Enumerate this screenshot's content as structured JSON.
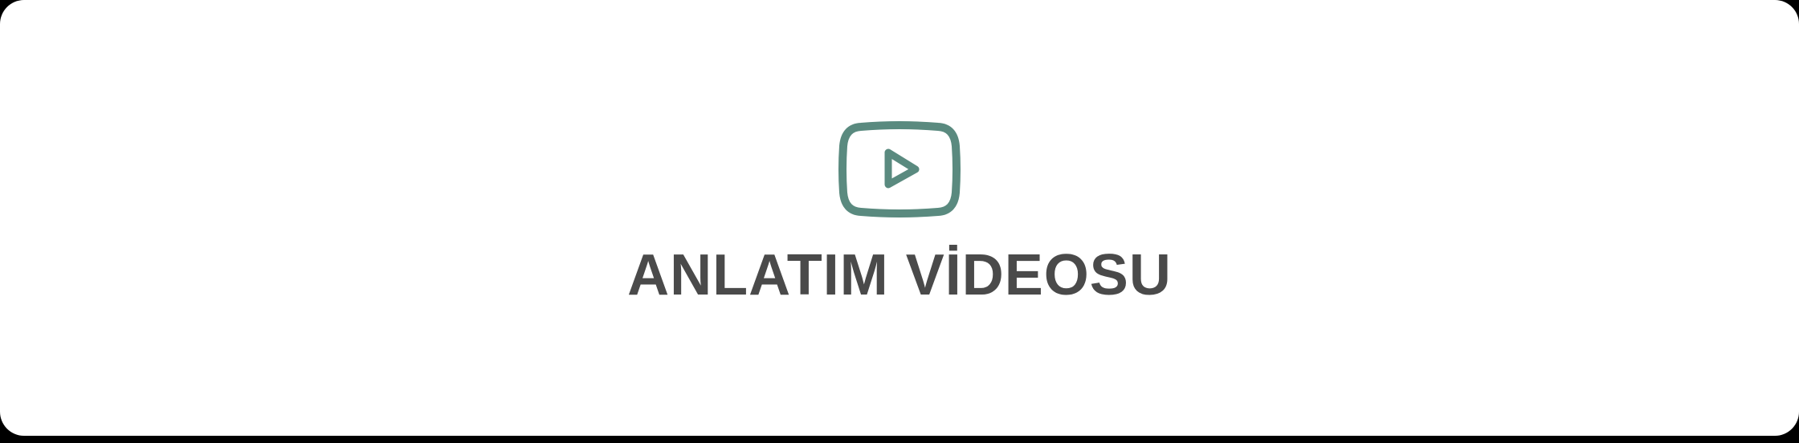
{
  "card": {
    "title": "ANLATIM VİDEOSU",
    "icon": "video-play-icon"
  },
  "colors": {
    "icon_stroke": "#5a8a7f",
    "title_text": "#4a4a4a",
    "card_background": "#ffffff",
    "page_background": "#000000"
  }
}
